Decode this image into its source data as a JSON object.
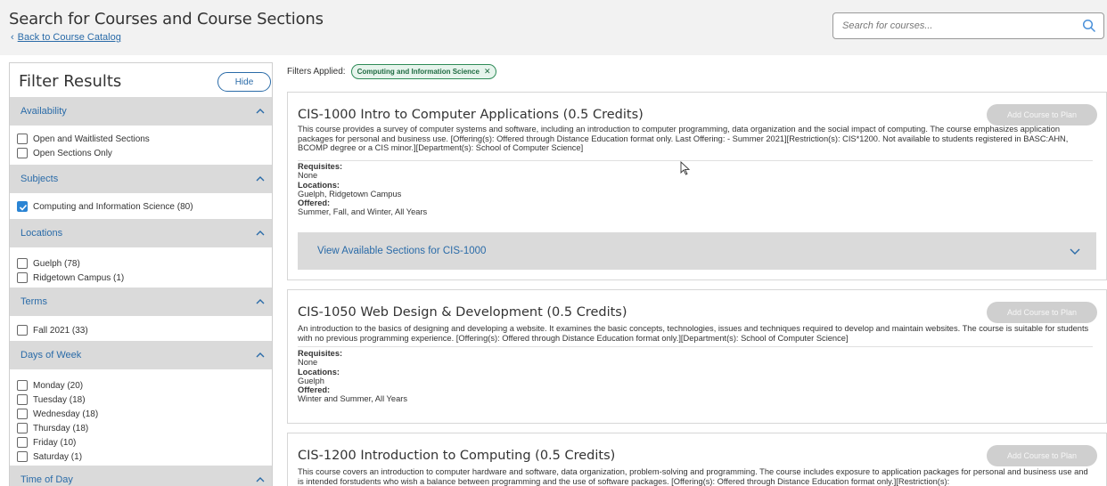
{
  "header": {
    "title": "Search for Courses and Course Sections",
    "back_link": "Back to Course Catalog",
    "search_placeholder": "Search for courses..."
  },
  "sidebar": {
    "title": "Filter Results",
    "hide_label": "Hide",
    "sections": [
      {
        "title": "Availability",
        "options": [
          {
            "label": "Open and Waitlisted Sections",
            "checked": false
          },
          {
            "label": "Open Sections Only",
            "checked": false
          }
        ]
      },
      {
        "title": "Subjects",
        "options": [
          {
            "label": "Computing and Information Science (80)",
            "checked": true
          }
        ]
      },
      {
        "title": "Locations",
        "options": [
          {
            "label": "Guelph (78)",
            "checked": false
          },
          {
            "label": "Ridgetown Campus (1)",
            "checked": false
          }
        ]
      },
      {
        "title": "Terms",
        "options": [
          {
            "label": "Fall 2021 (33)",
            "checked": false
          }
        ]
      },
      {
        "title": "Days of Week",
        "options": [
          {
            "label": "Monday (20)",
            "checked": false
          },
          {
            "label": "Tuesday (18)",
            "checked": false
          },
          {
            "label": "Wednesday (18)",
            "checked": false
          },
          {
            "label": "Thursday (18)",
            "checked": false
          },
          {
            "label": "Friday (10)",
            "checked": false
          },
          {
            "label": "Saturday (1)",
            "checked": false
          }
        ]
      },
      {
        "title": "Time of Day",
        "options": []
      }
    ]
  },
  "filters": {
    "label": "Filters Applied:",
    "pill": "Computing and Information Science"
  },
  "courses": [
    {
      "title": "CIS-1000 Intro to Computer Applications (0.5 Credits)",
      "add_label": "Add Course to Plan",
      "description": "This course provides a survey of computer systems and software, including an introduction to computer programming, data organization and the social impact of computing. The course emphasizes application packages for personal and business use. [Offering(s): Offered through Distance Education format only. Last Offering: - Summer 2021][Restriction(s): CIS*1200. Not available to students registered in BASC:AHN, BCOMP degree or a CIS minor.][Department(s): School of Computer Science]",
      "requisites_label": "Requisites:",
      "requisites": "None",
      "locations_label": "Locations:",
      "locations": "Guelph, Ridgetown Campus",
      "offered_label": "Offered:",
      "offered": "Summer, Fall, and Winter, All Years",
      "sections_label": "View Available Sections for CIS-1000"
    },
    {
      "title": "CIS-1050 Web Design & Development (0.5 Credits)",
      "add_label": "Add Course to Plan",
      "description": "An introduction to the basics of designing and developing a website. It examines the basic concepts, technologies, issues and techniques required to develop and maintain websites. The course is suitable for students with no previous programming experience. [Offering(s): Offered through Distance Education format only.][Department(s): School of Computer Science]",
      "requisites_label": "Requisites:",
      "requisites": "None",
      "locations_label": "Locations:",
      "locations": "Guelph",
      "offered_label": "Offered:",
      "offered": "Winter and Summer, All Years"
    },
    {
      "title": "CIS-1200 Introduction to Computing (0.5 Credits)",
      "add_label": "Add Course to Plan",
      "description": "This course covers an introduction to computer hardware and software, data organization, problem-solving and programming. The course includes exposure to application packages for personal and business use and is intended forstudents who wish a balance between programming and the use of software packages. [Offering(s): Offered through Distance Education format only.][Restriction(s):"
    }
  ]
}
